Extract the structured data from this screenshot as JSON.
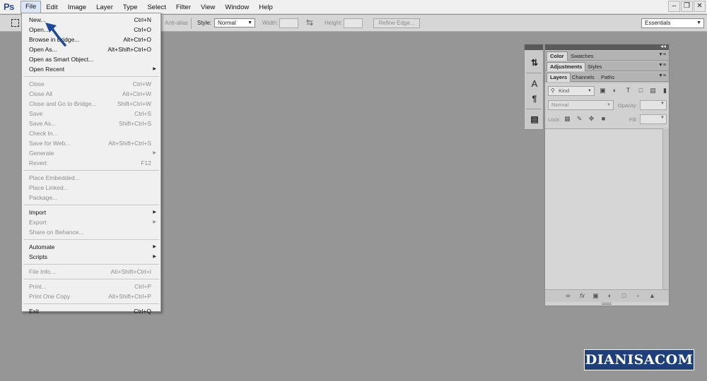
{
  "app": {
    "logo": "Ps"
  },
  "menubar": {
    "items": [
      {
        "label": "File",
        "active": true
      },
      {
        "label": "Edit"
      },
      {
        "label": "Image"
      },
      {
        "label": "Layer"
      },
      {
        "label": "Type"
      },
      {
        "label": "Select"
      },
      {
        "label": "Filter"
      },
      {
        "label": "View"
      },
      {
        "label": "Window"
      },
      {
        "label": "Help"
      }
    ],
    "window_controls": [
      "minimize",
      "restore",
      "close"
    ]
  },
  "options_bar": {
    "anti_alias": "Anti-alias",
    "style_label": "Style:",
    "style_value": "Normal",
    "width_label": "Width:",
    "height_label": "Height:",
    "refine_edge": "Refine Edge...",
    "workspace": "Essentials"
  },
  "file_menu": {
    "items": [
      {
        "label": "New...",
        "shortcut": "Ctrl+N",
        "enabled": true
      },
      {
        "label": "Open...",
        "shortcut": "Ctrl+O",
        "enabled": true
      },
      {
        "label": "Browse in Bridge...",
        "shortcut": "Alt+Ctrl+O",
        "enabled": true
      },
      {
        "label": "Open As...",
        "shortcut": "Alt+Shift+Ctrl+O",
        "enabled": true
      },
      {
        "label": "Open as Smart Object...",
        "shortcut": "",
        "enabled": true
      },
      {
        "label": "Open Recent",
        "shortcut": "",
        "enabled": true,
        "submenu": true
      },
      {
        "separator": true
      },
      {
        "label": "Close",
        "shortcut": "Ctrl+W",
        "enabled": false
      },
      {
        "label": "Close All",
        "shortcut": "Alt+Ctrl+W",
        "enabled": false
      },
      {
        "label": "Close and Go to Bridge...",
        "shortcut": "Shift+Ctrl+W",
        "enabled": false
      },
      {
        "label": "Save",
        "shortcut": "Ctrl+S",
        "enabled": false
      },
      {
        "label": "Save As...",
        "shortcut": "Shift+Ctrl+S",
        "enabled": false
      },
      {
        "label": "Check In...",
        "shortcut": "",
        "enabled": false
      },
      {
        "label": "Save for Web...",
        "shortcut": "Alt+Shift+Ctrl+S",
        "enabled": false
      },
      {
        "label": "Generate",
        "shortcut": "",
        "enabled": false,
        "submenu": true
      },
      {
        "label": "Revert",
        "shortcut": "F12",
        "enabled": false
      },
      {
        "separator": true
      },
      {
        "label": "Place Embedded...",
        "shortcut": "",
        "enabled": false
      },
      {
        "label": "Place Linked...",
        "shortcut": "",
        "enabled": false
      },
      {
        "label": "Package...",
        "shortcut": "",
        "enabled": false
      },
      {
        "separator": true
      },
      {
        "label": "Import",
        "shortcut": "",
        "enabled": true,
        "submenu": true
      },
      {
        "label": "Export",
        "shortcut": "",
        "enabled": false,
        "submenu": true
      },
      {
        "label": "Share on Behance...",
        "shortcut": "",
        "enabled": false
      },
      {
        "separator": true
      },
      {
        "label": "Automate",
        "shortcut": "",
        "enabled": true,
        "submenu": true
      },
      {
        "label": "Scripts",
        "shortcut": "",
        "enabled": true,
        "submenu": true
      },
      {
        "separator": true
      },
      {
        "label": "File Info...",
        "shortcut": "Alt+Shift+Ctrl+I",
        "enabled": false
      },
      {
        "separator": true
      },
      {
        "label": "Print...",
        "shortcut": "Ctrl+P",
        "enabled": false
      },
      {
        "label": "Print One Copy",
        "shortcut": "Alt+Shift+Ctrl+P",
        "enabled": false
      },
      {
        "separator": true
      },
      {
        "label": "Exit",
        "shortcut": "Ctrl+Q",
        "enabled": true
      }
    ]
  },
  "panels": {
    "tabs_row1": [
      "Color",
      "Swatches"
    ],
    "tabs_row2": [
      "Adjustments",
      "Styles"
    ],
    "tabs_row3": [
      "Layers",
      "Channels",
      "Paths"
    ],
    "kind": "Kind",
    "blend_mode": "Normal",
    "opacity_label": "Opacity:",
    "lock_label": "Lock:",
    "fill_label": "Fill:"
  },
  "watermark": "DIANISACOM",
  "colors": {
    "workspace_bg": "#969696",
    "watermark_bg": "#1e3f7a",
    "arrow": "#1f4a9a"
  }
}
